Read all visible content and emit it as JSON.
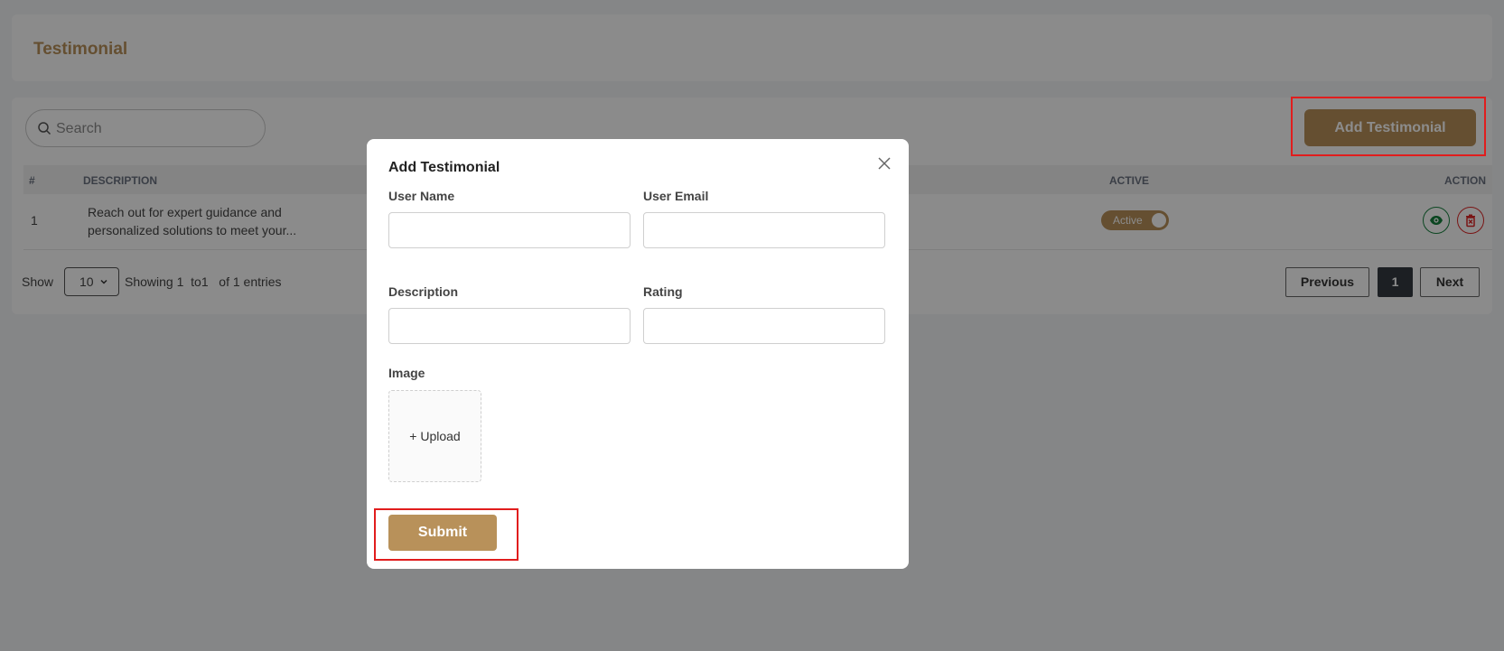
{
  "page": {
    "title": "Testimonial"
  },
  "toolbar": {
    "search_placeholder": "Search",
    "add_button": "Add Testimonial"
  },
  "table": {
    "headers": {
      "num": "#",
      "description": "DESCRIPTION",
      "active": "ACTIVE",
      "action": "ACTION"
    },
    "rows": [
      {
        "num": "1",
        "description_line1": "Reach out for expert guidance and",
        "description_line2": "personalized solutions to meet your...",
        "status": "Active"
      }
    ]
  },
  "footer": {
    "show_label": "Show",
    "page_size": "10",
    "entries_text": "Showing 1  to1   of 1 entries",
    "pagination": {
      "previous": "Previous",
      "current": "1",
      "next": "Next"
    }
  },
  "modal": {
    "title": "Add Testimonial",
    "fields": {
      "user_name": "User Name",
      "user_email": "User Email",
      "description": "Description",
      "rating": "Rating",
      "image": "Image"
    },
    "upload_label": "+ Upload",
    "submit_label": "Submit"
  },
  "colors": {
    "brand": "#b8915a",
    "highlight": "#e11d1d",
    "view": "#15803d",
    "delete": "#dc2626"
  },
  "icons": [
    "search-icon",
    "eye-icon",
    "trash-icon",
    "close-icon",
    "chevron-down-icon"
  ]
}
